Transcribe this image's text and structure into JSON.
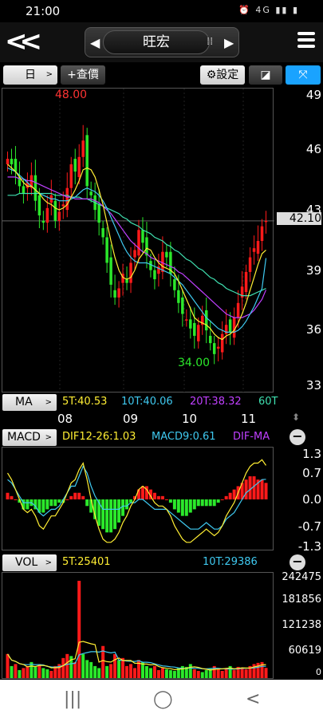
{
  "status": {
    "time": "21:00",
    "icons": "⏰ 4G ▮▮ ▮"
  },
  "header": {
    "stock_name": "旺宏",
    "prev_arrow": "◀",
    "next_arrow": "▶"
  },
  "toolbar": {
    "period": "日",
    "add_label": "+查價",
    "settings_label": "設定"
  },
  "price_axis": {
    "ticks": [
      "49",
      "46",
      "43",
      "39",
      "36",
      "33"
    ],
    "current": "42.10"
  },
  "chart_labels": {
    "high": "48.00",
    "low": "34.00"
  },
  "ma_bar": {
    "label": "MA",
    "ma5": "5T:40.53",
    "ma10": "10T:40.06",
    "ma20": "20T:38.32",
    "ma60": "60T"
  },
  "months": [
    "08",
    "09",
    "10",
    "11"
  ],
  "macd_bar": {
    "label": "MACD",
    "dif": "DIF12-26:1.03",
    "macd9": "MACD9:0.61",
    "difma": "DIF-MA"
  },
  "macd_axis": [
    "1.3",
    "0.7",
    "0.0",
    "-0.7",
    "-1.3"
  ],
  "vol_bar": {
    "label": "VOL",
    "v5": "5T:25401",
    "v10": "10T:29386"
  },
  "vol_axis": [
    "242475",
    "181856",
    "121238",
    "60619",
    "0"
  ],
  "colors": {
    "up": "#ff1a1a",
    "down": "#2be82b",
    "ma5": "#ffee33",
    "ma10": "#3fc9f0",
    "ma20": "#c040ff",
    "ma60": "#3fe0b0",
    "accent_blue": "#1aa3ff"
  },
  "chart_data": {
    "type": "candlestick",
    "x_groups": [
      "08",
      "09",
      "10",
      "11"
    ],
    "ylim": [
      33,
      49
    ],
    "high": 48.0,
    "low": 34.0,
    "last": 42.1,
    "closes": [
      45.5,
      45.2,
      44.8,
      44.0,
      43.6,
      44.2,
      44.6,
      43.2,
      42.4,
      42.0,
      42.8,
      43.5,
      42.1,
      42.6,
      43.0,
      43.9,
      45.2,
      44.8,
      45.6,
      46.5,
      44.0,
      43.5,
      42.7,
      42.0,
      41.2,
      39.8,
      38.6,
      37.9,
      38.4,
      39.2,
      38.7,
      39.8,
      40.5,
      41.6,
      40.9,
      40.2,
      39.4,
      38.9,
      39.6,
      40.4,
      40.1,
      39.2,
      38.3,
      37.6,
      37.0,
      36.7,
      36.2,
      35.8,
      36.4,
      36.9,
      36.1,
      35.4,
      34.8,
      35.2,
      35.9,
      36.4,
      36.0,
      36.8,
      37.6,
      38.5,
      39.3,
      40.1,
      40.6,
      41.0,
      41.8,
      42.1
    ],
    "ma5": [
      45.2,
      45.0,
      44.8,
      44.5,
      44.2,
      44.0,
      44.0,
      43.8,
      43.6,
      43.3,
      43.1,
      43.0,
      42.8,
      42.7,
      42.8,
      43.0,
      43.4,
      43.8,
      44.3,
      44.9,
      45.0,
      44.9,
      44.5,
      43.8,
      43.0,
      42.0,
      41.0,
      40.1,
      39.4,
      39.0,
      38.9,
      39.0,
      39.4,
      40.0,
      40.3,
      40.6,
      40.5,
      40.1,
      39.8,
      39.6,
      39.5,
      39.4,
      39.2,
      38.8,
      38.3,
      37.8,
      37.3,
      36.8,
      36.6,
      36.5,
      36.4,
      36.2,
      35.9,
      35.7,
      35.6,
      35.8,
      35.9,
      36.1,
      36.5,
      37.0,
      37.6,
      38.3,
      39.0,
      39.7,
      40.3,
      40.5
    ],
    "ma10": [
      45.0,
      44.9,
      44.8,
      44.6,
      44.4,
      44.2,
      44.0,
      43.8,
      43.6,
      43.5,
      43.4,
      43.3,
      43.3,
      43.2,
      43.2,
      43.2,
      43.3,
      43.4,
      43.6,
      43.8,
      43.9,
      43.8,
      43.7,
      43.5,
      43.2,
      42.8,
      42.3,
      41.8,
      41.3,
      40.8,
      40.4,
      40.1,
      39.9,
      39.8,
      39.8,
      39.8,
      39.7,
      39.6,
      39.5,
      39.4,
      39.3,
      39.2,
      39.0,
      38.8,
      38.6,
      38.3,
      38.0,
      37.7,
      37.4,
      37.1,
      36.8,
      36.6,
      36.4,
      36.2,
      36.1,
      36.0,
      36.0,
      36.0,
      36.1,
      36.3,
      36.6,
      37.0,
      37.4,
      37.9,
      38.4,
      40.06
    ],
    "ma20": [
      44.5,
      44.5,
      44.5,
      44.4,
      44.4,
      44.3,
      44.3,
      44.2,
      44.1,
      44.0,
      43.9,
      43.8,
      43.7,
      43.6,
      43.5,
      43.4,
      43.4,
      43.3,
      43.3,
      43.3,
      43.3,
      43.3,
      43.2,
      43.1,
      42.9,
      42.7,
      42.5,
      42.2,
      41.9,
      41.6,
      41.3,
      41.0,
      40.8,
      40.6,
      40.4,
      40.3,
      40.1,
      40.0,
      39.9,
      39.8,
      39.7,
      39.6,
      39.5,
      39.3,
      39.2,
      39.0,
      38.8,
      38.6,
      38.4,
      38.2,
      38.0,
      37.8,
      37.6,
      37.4,
      37.2,
      37.0,
      36.9,
      36.8,
      36.8,
      36.8,
      36.9,
      37.0,
      37.2,
      37.5,
      37.8,
      38.32
    ],
    "ma60": [
      43.5,
      43.5,
      43.5,
      43.6,
      43.6,
      43.6,
      43.6,
      43.6,
      43.6,
      43.6,
      43.6,
      43.6,
      43.5,
      43.5,
      43.5,
      43.5,
      43.4,
      43.4,
      43.4,
      43.3,
      43.3,
      43.2,
      43.1,
      43.0,
      42.9,
      42.8,
      42.7,
      42.6,
      42.5,
      42.3,
      42.2,
      42.0,
      41.9,
      41.8,
      41.6,
      41.5,
      41.4,
      41.2,
      41.1,
      41.0,
      40.8,
      40.7,
      40.5,
      40.4,
      40.2,
      40.0,
      39.9,
      39.7,
      39.5,
      39.4,
      39.2,
      39.0,
      38.9,
      38.7,
      38.6,
      38.4,
      38.3,
      38.2,
      38.1,
      38.0,
      38.0,
      38.0,
      38.1,
      38.2,
      38.3,
      38.4
    ],
    "macd_hist": [
      0.2,
      0.1,
      0.0,
      -0.1,
      -0.3,
      -0.3,
      -0.2,
      -0.3,
      -0.4,
      -0.4,
      -0.3,
      -0.2,
      -0.2,
      -0.1,
      -0.1,
      0.0,
      0.1,
      0.2,
      0.2,
      0.1,
      -0.2,
      -0.4,
      -0.6,
      -0.8,
      -0.9,
      -1.0,
      -1.0,
      -0.9,
      -0.7,
      -0.5,
      -0.3,
      -0.1,
      0.1,
      0.3,
      0.4,
      0.4,
      0.3,
      0.2,
      0.1,
      0.1,
      0.0,
      -0.1,
      -0.3,
      -0.4,
      -0.5,
      -0.5,
      -0.4,
      -0.3,
      -0.2,
      -0.2,
      -0.2,
      -0.2,
      -0.2,
      -0.1,
      0.0,
      0.1,
      0.2,
      0.3,
      0.4,
      0.5,
      0.6,
      0.7,
      0.7,
      0.6,
      0.6,
      0.5
    ],
    "dif": [
      0.8,
      0.6,
      0.3,
      0.0,
      -0.3,
      -0.4,
      -0.3,
      -0.5,
      -0.8,
      -0.9,
      -0.7,
      -0.5,
      -0.5,
      -0.3,
      -0.1,
      0.2,
      0.5,
      0.6,
      0.9,
      1.1,
      0.6,
      0.0,
      -0.5,
      -0.9,
      -1.2,
      -1.3,
      -1.3,
      -1.2,
      -1.0,
      -0.7,
      -0.5,
      -0.2,
      0.0,
      0.3,
      0.4,
      0.3,
      0.1,
      -0.1,
      -0.2,
      -0.2,
      -0.3,
      -0.5,
      -0.8,
      -1.0,
      -1.2,
      -1.3,
      -1.3,
      -1.2,
      -1.1,
      -1.0,
      -0.9,
      -1.0,
      -1.1,
      -1.0,
      -0.8,
      -0.5,
      -0.3,
      -0.1,
      0.2,
      0.5,
      0.8,
      1.0,
      1.1,
      1.1,
      1.2,
      1.03
    ],
    "macd9": [
      0.6,
      0.5,
      0.3,
      0.1,
      -0.1,
      -0.1,
      -0.1,
      -0.2,
      -0.4,
      -0.5,
      -0.4,
      -0.3,
      -0.3,
      -0.2,
      0.0,
      0.2,
      0.4,
      0.4,
      0.7,
      1.0,
      0.8,
      0.4,
      0.1,
      -0.1,
      -0.3,
      -0.3,
      -0.3,
      -0.3,
      -0.3,
      -0.2,
      -0.2,
      -0.1,
      -0.1,
      0.0,
      0.0,
      -0.1,
      -0.2,
      -0.3,
      -0.3,
      -0.3,
      -0.3,
      -0.4,
      -0.5,
      -0.6,
      -0.7,
      -0.8,
      -0.9,
      -0.9,
      -0.9,
      -0.8,
      -0.7,
      -0.8,
      -0.9,
      -0.9,
      -0.8,
      -0.6,
      -0.5,
      -0.4,
      -0.2,
      0.0,
      0.2,
      0.3,
      0.4,
      0.5,
      0.6,
      0.61
    ],
    "volume": [
      60000,
      30000,
      35000,
      20000,
      25000,
      30000,
      40000,
      28000,
      35000,
      25000,
      22000,
      18000,
      30000,
      35000,
      50000,
      60000,
      55000,
      40000,
      242475,
      60000,
      45000,
      40000,
      30000,
      25000,
      80000,
      30000,
      35000,
      60000,
      45000,
      50000,
      30000,
      35000,
      25000,
      45000,
      40000,
      30000,
      25000,
      30000,
      20000,
      25000,
      22000,
      20000,
      18000,
      25000,
      30000,
      28000,
      35000,
      22000,
      18000,
      15000,
      20000,
      25000,
      30000,
      22000,
      18000,
      25000,
      30000,
      20000,
      28000,
      25000,
      22000,
      30000,
      35000,
      38000,
      40000,
      25401
    ],
    "volume_up": [
      1,
      0,
      1,
      0,
      1,
      1,
      0,
      0,
      1,
      0,
      0,
      1,
      1,
      1,
      1,
      1,
      0,
      1,
      1,
      0,
      0,
      0,
      0,
      0,
      1,
      0,
      1,
      1,
      0,
      1,
      1,
      1,
      1,
      1,
      0,
      0,
      0,
      1,
      1,
      1,
      0,
      0,
      0,
      0,
      0,
      0,
      0,
      1,
      1,
      0,
      0,
      0,
      1,
      1,
      1,
      1,
      0,
      1,
      1,
      1,
      1,
      1,
      1,
      1,
      1,
      1
    ]
  }
}
